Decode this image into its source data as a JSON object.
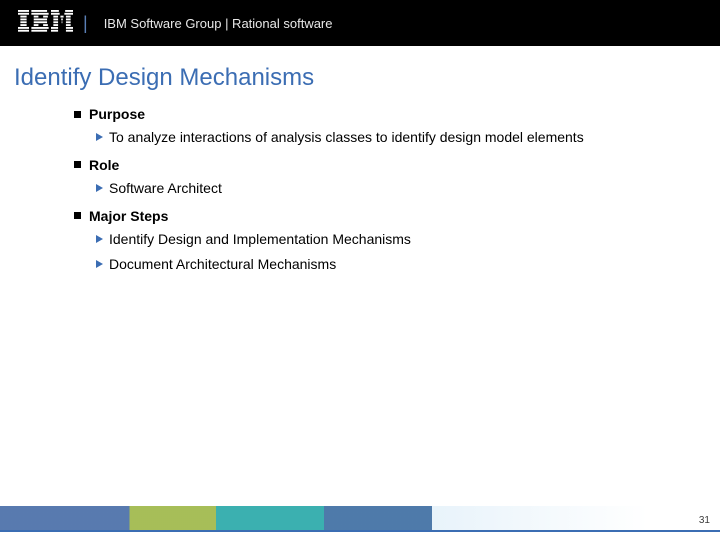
{
  "header": {
    "logo_label": "IBM",
    "text": "IBM Software Group | Rational software"
  },
  "title": "Identify Design Mechanisms",
  "sections": [
    {
      "heading": "Purpose",
      "items": [
        "To analyze interactions of analysis classes to identify design model elements"
      ]
    },
    {
      "heading": "Role",
      "items": [
        "Software Architect"
      ]
    },
    {
      "heading": "Major Steps",
      "items": [
        "Identify Design and Implementation Mechanisms",
        "Document Architectural Mechanisms"
      ]
    }
  ],
  "footer": {
    "page_number": "31"
  }
}
